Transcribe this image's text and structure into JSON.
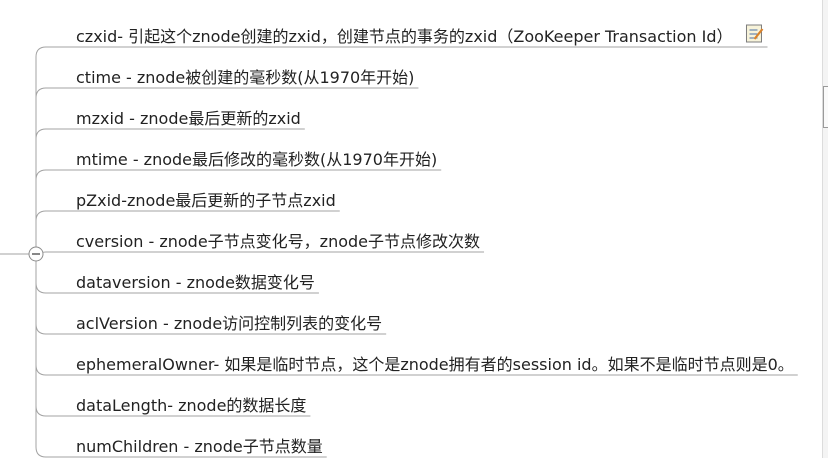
{
  "topics": [
    {
      "id": "czxid",
      "text": "czxid- 引起这个znode创建的zxid，创建节点的事务的zxid（ZooKeeper Transaction Id）",
      "has_note": true
    },
    {
      "id": "ctime",
      "text": "ctime - znode被创建的毫秒数(从1970年开始)"
    },
    {
      "id": "mzxid",
      "text": "mzxid - znode最后更新的zxid"
    },
    {
      "id": "mtime",
      "text": "mtime - znode最后修改的毫秒数(从1970年开始)"
    },
    {
      "id": "pzxid",
      "text": "pZxid-znode最后更新的子节点zxid"
    },
    {
      "id": "cversion",
      "text": "cversion - znode子节点变化号，znode子节点修改次数"
    },
    {
      "id": "dataversion",
      "text": "dataversion - znode数据变化号"
    },
    {
      "id": "aclversion",
      "text": "aclVersion - znode访问控制列表的变化号"
    },
    {
      "id": "ephemeralowner",
      "text": "ephemeralOwner- 如果是临时节点，这个是znode拥有者的session id。如果不是临时节点则是0。"
    },
    {
      "id": "datalength",
      "text": "dataLength- znode的数据长度"
    },
    {
      "id": "numchildren",
      "text": "numChildren - znode子节点数量"
    }
  ],
  "colors": {
    "branch_line": "#a3a3a3",
    "topic_text": "#222222",
    "collapse_button_border": "#8c8c8c"
  },
  "icons": {
    "collapse": "minus-circle-icon",
    "note": "note-icon"
  }
}
